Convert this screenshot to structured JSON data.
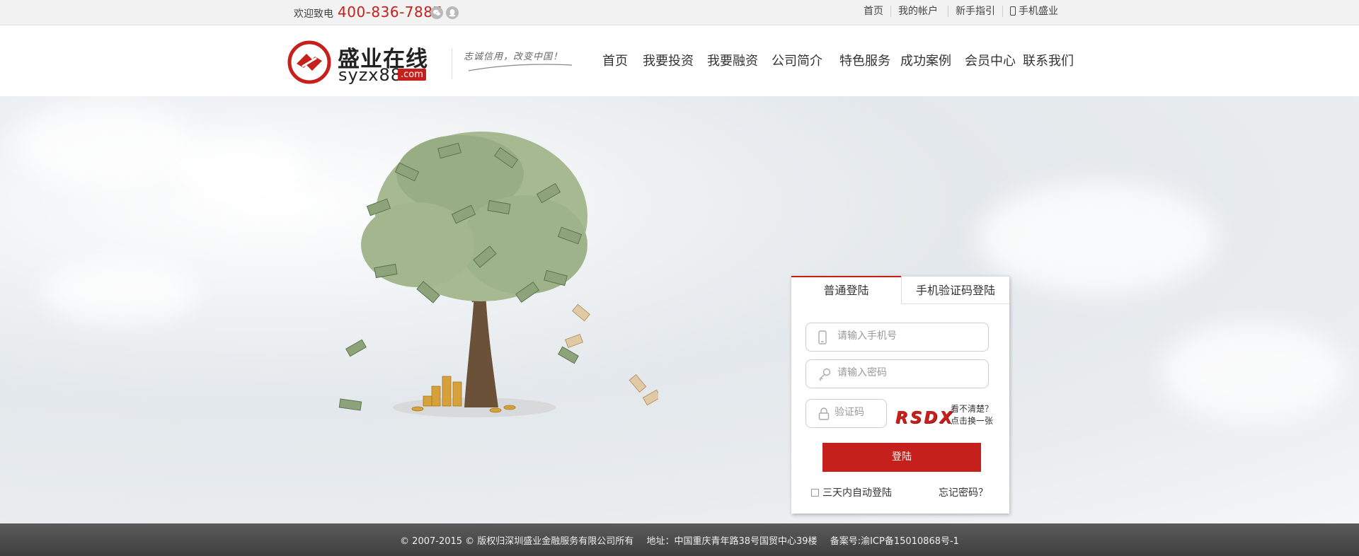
{
  "topbar": {
    "welcome": "欢迎致电",
    "phone": "400-836-7887",
    "links": [
      "首页",
      "我的帐户",
      "新手指引",
      "手机盛业"
    ]
  },
  "header": {
    "logo_text": "盛业在线",
    "logo_sub": "syzx88",
    "logo_com": ".com",
    "slogan": "志诚信用，改变中国！",
    "nav": [
      "首页",
      "我要投资",
      "我要融资",
      "公司简介",
      "特色服务",
      "成功案例",
      "会员中心",
      "联系我们"
    ]
  },
  "login": {
    "tab_normal": "普通登陆",
    "tab_sms": "手机验证码登陆",
    "phone_placeholder": "请输入手机号",
    "password_placeholder": "请输入密码",
    "captcha_placeholder": "验证码",
    "captcha_text": "RSDX",
    "refresh_line1": "看不清楚？",
    "refresh_line2": "点击换一张",
    "submit": "登陆",
    "remember": "三天内自动登陆",
    "forgot": "忘记密码？"
  },
  "footer": {
    "copyright": "© 2007-2015 © 版权归深圳盛业金融服务有限公司所有",
    "address": "地址：中国重庆青年路38号国贸中心39楼",
    "icp": "备案号:渝ICP备15010868号-1"
  },
  "colors": {
    "brand_red": "#c6201c",
    "footer_bg": "#4a4a4a",
    "topbar_bg": "#f2f2f2"
  }
}
